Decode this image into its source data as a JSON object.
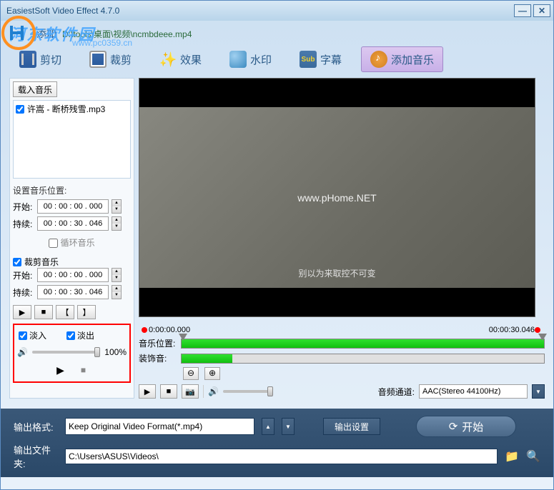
{
  "window": {
    "title": "EasiestSoft Video Effect 4.7.0"
  },
  "watermark": {
    "text": "河东软件园",
    "sub": "www.pc0359.cn"
  },
  "addbar": {
    "label": "添加",
    "path": "D:\\tools\\桌面\\视频\\ncmbdeee.mp4"
  },
  "tabs": {
    "jianqie": "剪切",
    "caijian": "裁剪",
    "xiaoguo": "效果",
    "shuiyin": "水印",
    "zimu": "字幕",
    "addmusic": "添加音乐",
    "zimu_icon": "Sub"
  },
  "leftpanel": {
    "loadmusic": "载入音乐",
    "musicitem": "许嵩 - 断桥残雪.mp3",
    "setpos_title": "设置音乐位置:",
    "start_label": "开始:",
    "start_value": "00 : 00 : 00 . 000",
    "dur_label": "持续:",
    "dur_value": "00 : 00 : 30 . 046",
    "loop": "循环音乐",
    "trim_title": "裁剪音乐",
    "trim_start": "00 : 00 : 00 . 000",
    "trim_dur": "00 : 00 : 30 . 046",
    "bracket_open": "【",
    "bracket_close": "】",
    "fadein": "淡入",
    "fadeout": "淡出",
    "volpct": "100%"
  },
  "preview": {
    "watermark": "www.pHome.NET",
    "subtitle": "别以为来取控不可变"
  },
  "timeline": {
    "t0": "0:00:00.000",
    "t1": "00:00:30.046",
    "track1_label": "音乐位置:",
    "track2_label": "装饰音:",
    "audio_label": "音频通道:",
    "audio_value": "AAC(Stereo 44100Hz)"
  },
  "bottom": {
    "format_label": "输出格式:",
    "format_value": "Keep Original Video Format(*.mp4)",
    "outset": "输出设置",
    "start": "开始",
    "folder_label": "输出文件夹:",
    "folder_value": "C:\\Users\\ASUS\\Videos\\"
  }
}
